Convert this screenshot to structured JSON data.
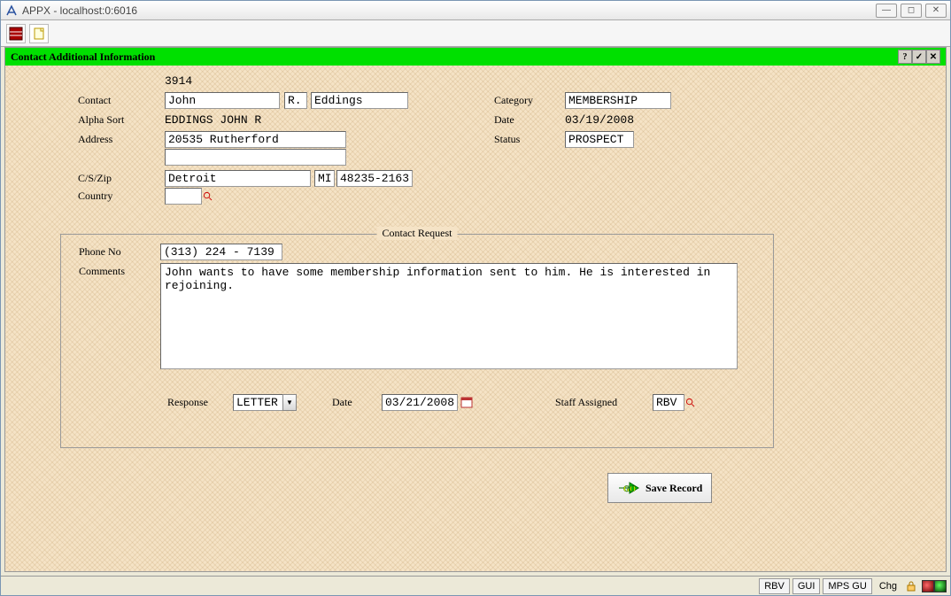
{
  "window": {
    "title": "APPX - localhost:0:6016"
  },
  "header": {
    "title": "Contact Additional Information"
  },
  "contact": {
    "id": "3914",
    "first": "John",
    "middle": "R.",
    "last": "Eddings",
    "alpha_sort": "EDDINGS JOHN R",
    "address1": "20535 Rutherford",
    "address2": "",
    "city": "Detroit",
    "state": "MI",
    "zip": "48235-2163",
    "country": ""
  },
  "right": {
    "category_label": "Category",
    "category": "MEMBERSHIP",
    "date_label": "Date",
    "date": "03/19/2008",
    "status_label": "Status",
    "status": "PROSPECT"
  },
  "labels": {
    "contact": "Contact",
    "alpha_sort": "Alpha Sort",
    "address": "Address",
    "cszip": "C/S/Zip",
    "country": "Country",
    "phone": "Phone No",
    "comments": "Comments",
    "response": "Response",
    "date": "Date",
    "staff": "Staff Assigned"
  },
  "request": {
    "legend": "Contact Request",
    "phone": "(313) 224 - 7139",
    "comments": "John wants to have some membership information sent to him. He is interested in rejoining.",
    "response": "LETTER",
    "date": "03/21/2008",
    "staff": "RBV"
  },
  "buttons": {
    "save": "Save Record"
  },
  "status": {
    "b1": "RBV",
    "b2": "GUI",
    "b3": "MPS GU",
    "b4": "Chg"
  }
}
